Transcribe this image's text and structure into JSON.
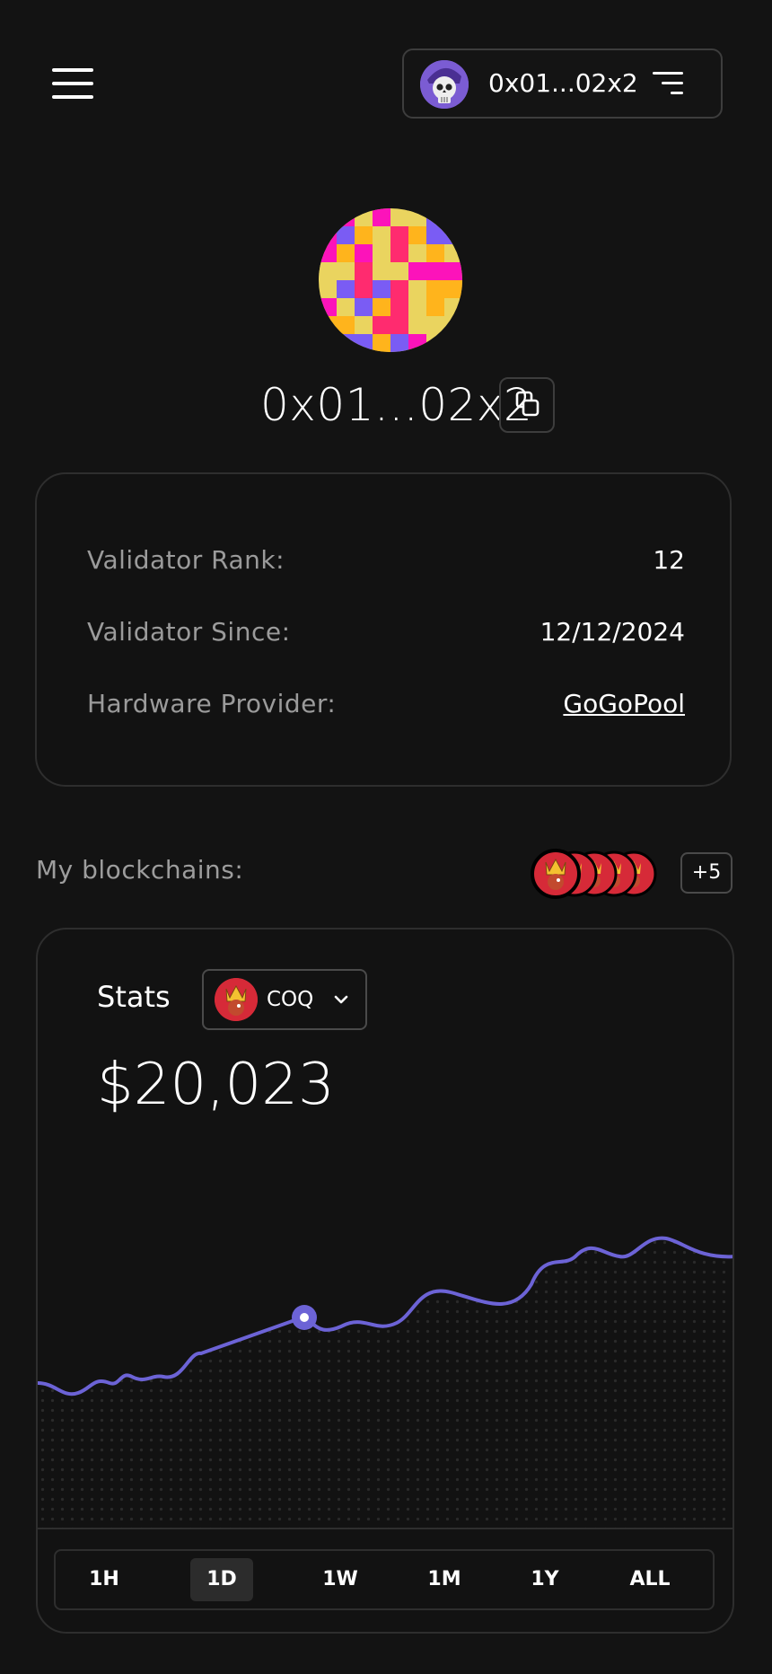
{
  "header": {
    "menu_icon": "hamburger-icon",
    "wallet_address": "0x01...02x2",
    "wallet_avatar_icon": "skull-avatar-icon",
    "filter_icon": "filter-lines-icon"
  },
  "profile": {
    "address": "0x01...02x2",
    "copy_icon": "copy-icon"
  },
  "info": {
    "rows": [
      {
        "label": "Validator Rank:",
        "value": "12"
      },
      {
        "label": "Validator Since:",
        "value": "12/12/2024"
      },
      {
        "label": "Hardware Provider:",
        "value": "GoGoPool"
      }
    ]
  },
  "blockchains": {
    "label": "My blockchains:",
    "more": "+5"
  },
  "stats": {
    "label": "Stats",
    "selected_coin": "COQ",
    "value": "$20,023",
    "timeframes": [
      "1H",
      "1D",
      "1W",
      "1M",
      "1Y",
      "ALL"
    ],
    "active_timeframe": "1D",
    "accent_color": "#6c63d6"
  }
}
